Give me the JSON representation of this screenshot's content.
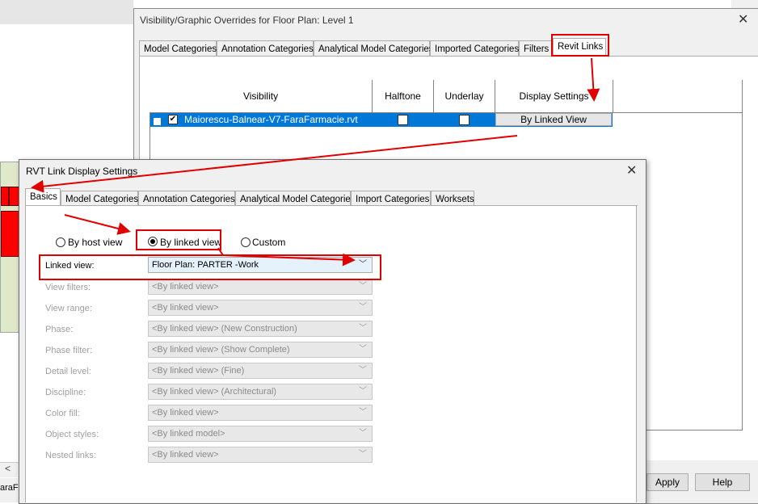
{
  "background_app": {
    "bottom_text": "araFarmacie",
    "scroll_left_arrow": "<"
  },
  "vg_dialog": {
    "title": "Visibility/Graphic Overrides for Floor Plan: Level 1",
    "close_glyph": "✕",
    "tabs": [
      "Model Categories",
      "Annotation Categories",
      "Analytical Model Categories",
      "Imported Categories",
      "Filters",
      "Revit Links"
    ],
    "selected_tab": "Revit Links",
    "columns": [
      "Visibility",
      "Halftone",
      "Underlay",
      "Display Settings"
    ],
    "row": {
      "expander": "+",
      "visible_checked": true,
      "check_glyph": "✔",
      "name": "Maiorescu-Balnear-V7-FaraFarmacie.rvt",
      "halftone_checked": false,
      "underlay_checked": false,
      "display_setting": "By Linked View"
    },
    "buttons": {
      "apply": "Apply",
      "help": "Help"
    }
  },
  "rvt_dialog": {
    "title": "RVT Link Display Settings",
    "close_glyph": "✕",
    "tabs": [
      "Basics",
      "Model Categories",
      "Annotation Categories",
      "Analytical Model Categories",
      "Import Categories",
      "Worksets"
    ],
    "selected_tab": "Basics",
    "radio_options": [
      {
        "label": "By host view",
        "selected": false
      },
      {
        "label": "By linked view",
        "selected": true
      },
      {
        "label": "Custom",
        "selected": false
      }
    ],
    "settings": [
      {
        "label": "Linked view:",
        "value": "Floor Plan: PARTER -Work",
        "enabled": true
      },
      {
        "label": "View filters:",
        "value": "<By linked view>",
        "enabled": false
      },
      {
        "label": "View range:",
        "value": "<By linked view>",
        "enabled": false
      },
      {
        "label": "Phase:",
        "value": "<By linked view> (New Construction)",
        "enabled": false
      },
      {
        "label": "Phase filter:",
        "value": "<By linked view> (Show Complete)",
        "enabled": false
      },
      {
        "label": "Detail level:",
        "value": "<By linked view> (Fine)",
        "enabled": false
      },
      {
        "label": "Discipline:",
        "value": "<By linked view> (Architectural)",
        "enabled": false
      },
      {
        "label": "Color fill:",
        "value": "<By linked view>",
        "enabled": false
      },
      {
        "label": "Object styles:",
        "value": "<By linked model>",
        "enabled": false
      },
      {
        "label": "Nested links:",
        "value": "<By linked view>",
        "enabled": false
      }
    ],
    "dropdown_glyph": "﹀"
  },
  "colors": {
    "annotation_red": "#e00000",
    "selection_blue": "#0078d7"
  }
}
